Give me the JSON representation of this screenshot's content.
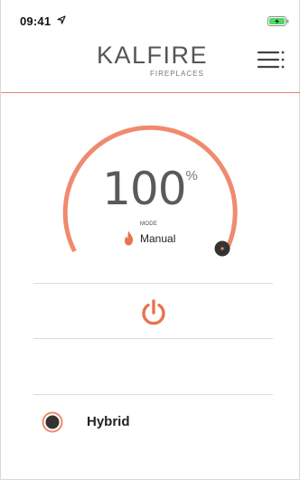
{
  "status_bar": {
    "time": "09:41",
    "icons": [
      "location-arrow-icon",
      "battery-charging-icon"
    ],
    "battery_color": "#4cd964"
  },
  "header": {
    "brand_name": "KALFIRE",
    "brand_sub": "FIREPLACES",
    "menu_icon": "hamburger-menu-icon",
    "accent_color": "#e8836b"
  },
  "dial": {
    "value": "100",
    "unit": "%",
    "level_percent": 100,
    "mode_label": "MODE",
    "mode_value": "Manual",
    "mode_icon": "flame-icon",
    "arc_color": "#f08a6e",
    "knob_color": "#333333"
  },
  "power": {
    "icon": "power-icon",
    "color": "#e8734f"
  },
  "hybrid": {
    "label": "Hybrid",
    "icon": "radio-button-icon"
  }
}
